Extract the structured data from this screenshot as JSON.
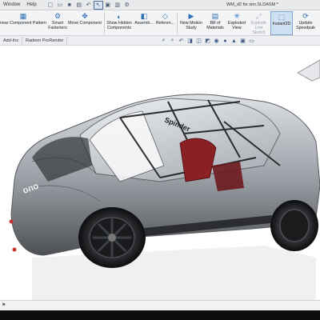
{
  "menu": [
    "Window",
    "Help"
  ],
  "document_title": "WM_d2 for sim.SLDASM *",
  "ribbon_buttons": [
    {
      "label": "near Component Pattern",
      "icon": "pattern-icon"
    },
    {
      "label": "Smart\nFasteners",
      "icon": "fastener-icon"
    },
    {
      "label": "Move Component",
      "icon": "move-icon"
    },
    {
      "label": "Show Hidden\nComponents",
      "icon": "show-hidden-icon"
    },
    {
      "label": "Assemb...",
      "icon": "assembly-icon"
    },
    {
      "label": "Referen...",
      "icon": "reference-icon"
    },
    {
      "label": "New Motion\nStudy",
      "icon": "motion-study-icon"
    },
    {
      "label": "Bill of\nMaterials",
      "icon": "bom-icon"
    },
    {
      "label": "Exploded\nView",
      "icon": "exploded-view-icon"
    },
    {
      "label": "Explode\nLine Sketch",
      "icon": "explode-line-icon"
    },
    {
      "label": "Instant3D",
      "icon": "instant3d-icon"
    },
    {
      "label": "Update\nSpeedpak",
      "icon": "speedpak-icon"
    }
  ],
  "tabs": [
    "Add-Ins",
    "Radeon ProRender"
  ],
  "car": {
    "decal_1": "Spinder",
    "decal_2": "ono"
  },
  "colors": {
    "ribbon_bg": "#f3f4f6",
    "active_button": "#cfe0f3",
    "accent": "#2f6fb4",
    "seat": "#8a1f24",
    "rim": "#1a1b1d"
  }
}
